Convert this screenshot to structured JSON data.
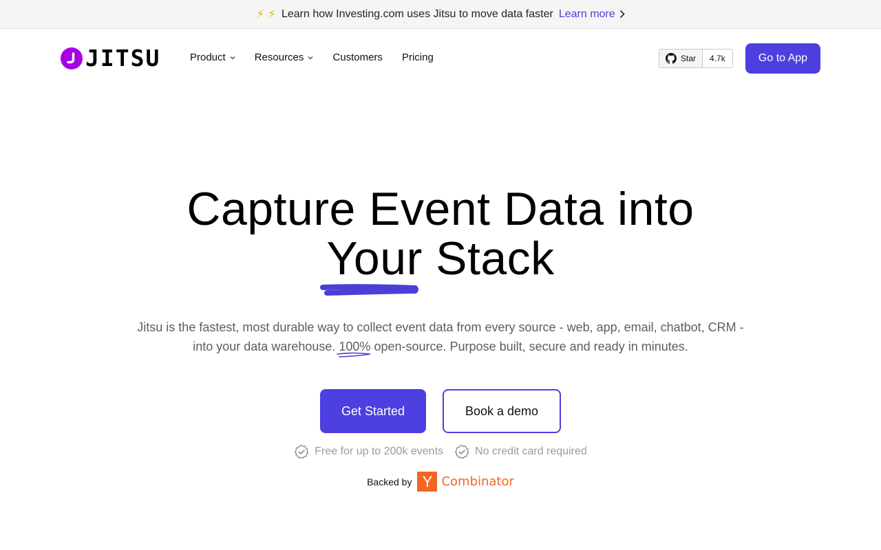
{
  "announcement": {
    "bolts": "⚡ ⚡",
    "message": "Learn how Investing.com uses Jitsu to move data faster",
    "link_label": "Learn more"
  },
  "header": {
    "logo_text": "JITSU",
    "nav": [
      {
        "label": "Product",
        "has_dropdown": true
      },
      {
        "label": "Resources",
        "has_dropdown": true
      },
      {
        "label": "Customers",
        "has_dropdown": false
      },
      {
        "label": "Pricing",
        "has_dropdown": false
      }
    ],
    "github": {
      "star_label": "Star",
      "count": "4.7k",
      "icon": "github-icon"
    },
    "cta_label": "Go to App"
  },
  "hero": {
    "title_line1": "Capture Event Data into",
    "title_line2": "Your Stack",
    "subtitle_part1": "Jitsu is the fastest, most durable way to collect event data from every source - web, app, email, chatbot, CRM - into your data warehouse.",
    "subtitle_highlight": "100%",
    "subtitle_part2": "open-source. Purpose built, secure and ready in minutes.",
    "primary_button": "Get Started",
    "secondary_button": "Book a demo",
    "checks": [
      "Free for up to 200k events",
      "No credit card required"
    ],
    "backed_label": "Backed by",
    "yc_letter": "Y",
    "yc_word": "Combinator"
  },
  "colors": {
    "brand": "#4d3fe0",
    "logo": "#a500e6",
    "yc": "#f26522",
    "announce_bg": "#f5f5f5"
  }
}
